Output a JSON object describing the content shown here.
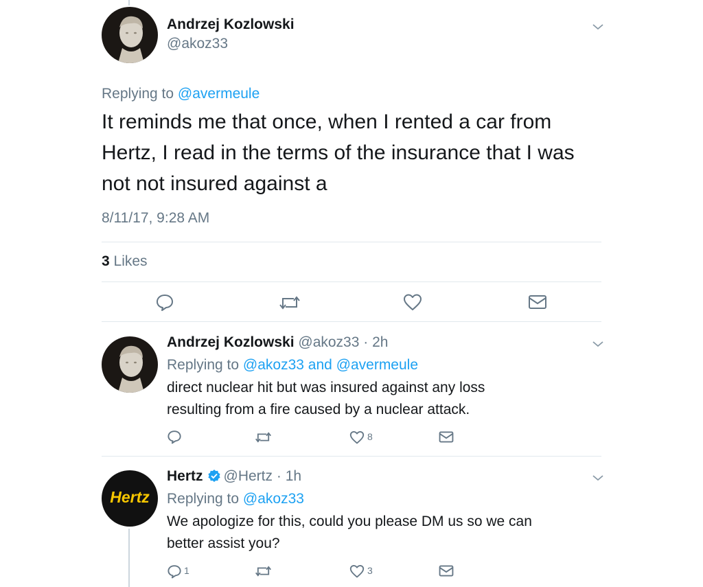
{
  "main_tweet": {
    "author_name": "Andrzej Kozlowski",
    "author_handle": "@akoz33",
    "replying_prefix": "Replying to ",
    "replying_to": "@avermeule",
    "text_lines": [
      "It reminds me that once, when I rented a car from",
      "Hertz, I read in the terms of the insurance that I was",
      "not not insured against a"
    ],
    "timestamp": "8/11/17, 9:28 AM",
    "likes_count": "3",
    "likes_label": " Likes"
  },
  "replies": [
    {
      "author_name": "Andrzej Kozlowski",
      "author_handle": "@akoz33",
      "time": "2h",
      "replying_prefix": "Replying to ",
      "replying_to": "@akoz33 and @avermeule",
      "text_lines": [
        "direct nuclear hit but  was insured against any loss",
        "resulting from a fire caused by a nuclear attack."
      ],
      "reply_count": "",
      "like_count": "8"
    },
    {
      "author_name": "Hertz",
      "author_handle": "@Hertz",
      "time": "1h",
      "verified": true,
      "avatar_text": "Hertz",
      "replying_prefix": "Replying to ",
      "replying_to": "@akoz33",
      "text_lines": [
        "We apologize for this, could you please DM us so we can",
        "better assist you?"
      ],
      "reply_count": "1",
      "like_count": "3"
    }
  ],
  "colors": {
    "link": "#1da1f2",
    "secondary_text": "#657786",
    "divider": "#e1e8ed",
    "hertz_yellow": "#f7c600"
  },
  "separator": " · "
}
